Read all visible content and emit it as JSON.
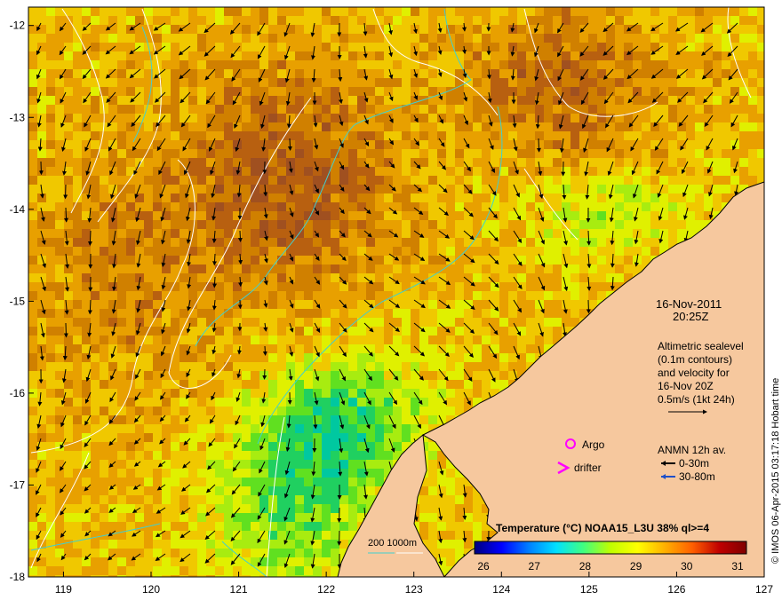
{
  "map": {
    "lon_range": [
      118.6,
      127.0
    ],
    "lat_range": [
      -18.0,
      -11.8
    ],
    "lon_ticks": [
      "119",
      "120",
      "121",
      "122",
      "123",
      "124",
      "125",
      "126",
      "127"
    ],
    "lat_ticks": [
      "-12",
      "-13",
      "-14",
      "-15",
      "-16",
      "-17",
      "-18"
    ],
    "colors": {
      "land": "#f6c89e",
      "coast": "#000000",
      "contour_white": "#ffffff",
      "contour_cyan": "#40d0d0",
      "arrow": "#000000"
    }
  },
  "info": {
    "date": "16-Nov-2011",
    "time": "20:25Z",
    "description": [
      "Altimetric sealevel",
      "(0.1m contours)",
      "and velocity for",
      "16-Nov 20Z",
      "0.5m/s (1kt 24h)"
    ],
    "legend_argo": "Argo",
    "legend_drifter": "drifter",
    "anmn_title": "ANMN 12h av.",
    "anmn_shallow": "0-30m",
    "anmn_deep": "30-80m",
    "isobath_label": "200  1000m",
    "credit": "© IMOS 06-Apr-2015 03:17:18 Hobart time"
  },
  "colorbar": {
    "title": "Temperature (°C) NOAA15_L3U 38% ql>=4",
    "ticks": [
      "26",
      "27",
      "28",
      "29",
      "30",
      "31"
    ],
    "colors": [
      "#00007f",
      "#0000ff",
      "#0080ff",
      "#00e0ff",
      "#40ff80",
      "#c0ff00",
      "#ffff00",
      "#ffb000",
      "#ff6000",
      "#c00000",
      "#7f0000"
    ]
  }
}
